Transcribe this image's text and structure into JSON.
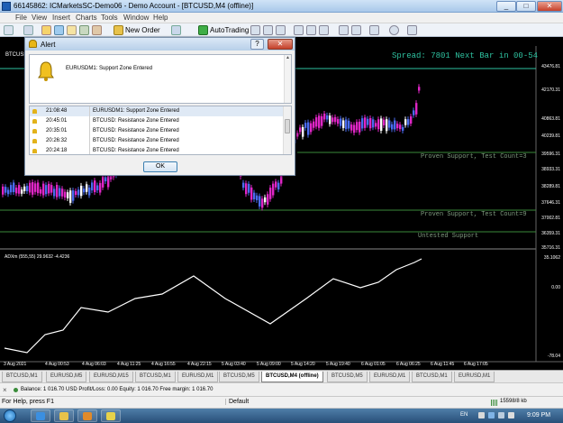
{
  "window": {
    "title": "66145862: ICMarketsSC-Demo06 - Demo Account - [BTCUSD,M4 (offline)]",
    "controls": [
      "_",
      "□",
      "✕"
    ]
  },
  "menu": [
    "File",
    "View",
    "Insert",
    "Charts",
    "Tools",
    "Window",
    "Help"
  ],
  "toolbar": {
    "new_order": "New Order",
    "autotrading": "AutoTrading"
  },
  "chart": {
    "symbol": "BTCUSD",
    "spread_text": "Spread: 7801 Next Bar in 00-54",
    "price_labels": [
      "43476.81",
      "42170.31",
      "40863.81",
      "40239.81",
      "39596.31",
      "38933.31",
      "38289.81",
      "37646.31",
      "37002.81",
      "36359.31",
      "35716.31"
    ],
    "zones": [
      {
        "label": "Proven Support, Test Count=3"
      },
      {
        "label": "Proven Support, Test Count=9"
      },
      {
        "label": "Untested Support"
      }
    ],
    "indicator_label": "ADXm (555,55) 29.9632 -4.4236",
    "indicator_scale": [
      "35.1062",
      "0.00",
      "-78.04"
    ],
    "time_labels": [
      "3 Aug 2021",
      "4 Aug 00:53",
      "4 Aug 06:03",
      "4 Aug 11:25",
      "4 Aug 16:55",
      "4 Aug 22:15",
      "5 Aug 03:40",
      "5 Aug 09:00",
      "5 Aug 14:20",
      "5 Aug 19:40",
      "6 Aug 01:05",
      "6 Aug 06:25",
      "6 Aug 11:45",
      "6 Aug 17:05"
    ],
    "colors": {
      "bull": "#4a6cf0",
      "bear": "#e026c6",
      "highlight": "#ffffff",
      "zone_line": "#3a8a3a",
      "spread": "#2ec2a0"
    }
  },
  "alert": {
    "title": "Alert",
    "message": "EURUSDM1: Support Zone Entered",
    "rows": [
      {
        "time": "21:08:48",
        "msg": "EURUSDM1: Support Zone Entered"
      },
      {
        "time": "20:45:01",
        "msg": "BTCUSD: Resistance Zone Entered"
      },
      {
        "time": "20:35:01",
        "msg": "BTCUSD: Resistance Zone Entered"
      },
      {
        "time": "20:26:32",
        "msg": "BTCUSD: Resistance Zone Entered"
      },
      {
        "time": "20:24:18",
        "msg": "BTCUSD: Resistance Zone Entered"
      }
    ],
    "ok_label": "OK",
    "help_label": "?",
    "close_label": "✕"
  },
  "tabs": [
    {
      "label": "BTCUSD,M1",
      "active": false
    },
    {
      "label": "EURUSD,M5",
      "active": false
    },
    {
      "label": "EURUSD,M15",
      "active": false
    },
    {
      "label": "BTCUSD,M1",
      "active": false
    },
    {
      "label": "EURUSD,M1",
      "active": false
    },
    {
      "label": "BTCUSD,M5",
      "active": false
    },
    {
      "label": "BTCUSD,M4 (offline)",
      "active": true
    },
    {
      "label": "BTCUSD,M5",
      "active": false
    },
    {
      "label": "EURUSD,M1",
      "active": false
    },
    {
      "label": "BTCUSD,M1",
      "active": false
    },
    {
      "label": "EURUSD,M1",
      "active": false
    }
  ],
  "terminal": {
    "close_glyph": "×",
    "balance_line": "Balance: 1 016.70 USD  Profit/Loss: 0.00  Equity: 1 016.70  Free margin: 1 016.70"
  },
  "status": {
    "help": "For Help, press F1",
    "profile": "Default",
    "traffic": "15598/8 kb"
  },
  "taskbar": {
    "lang": "EN",
    "time": "9:09 PM"
  }
}
